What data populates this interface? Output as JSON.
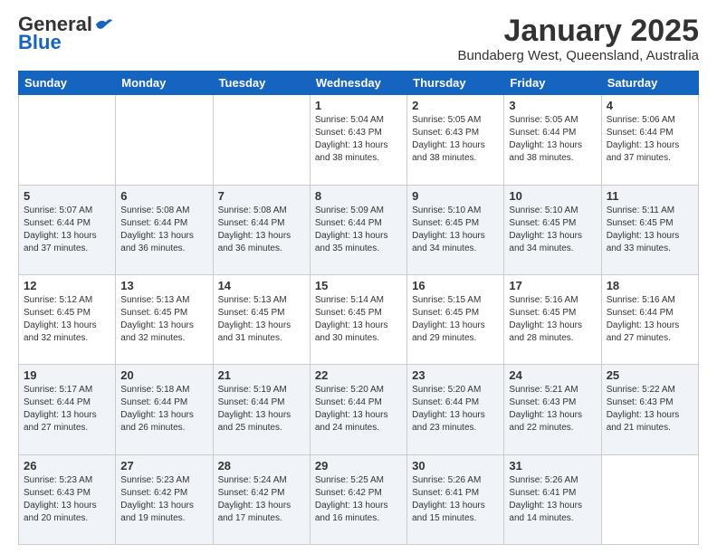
{
  "header": {
    "logo": {
      "general": "General",
      "blue": "Blue"
    },
    "title": "January 2025",
    "location": "Bundaberg West, Queensland, Australia"
  },
  "weekdays": [
    "Sunday",
    "Monday",
    "Tuesday",
    "Wednesday",
    "Thursday",
    "Friday",
    "Saturday"
  ],
  "weeks": [
    [
      {
        "day": "",
        "info": ""
      },
      {
        "day": "",
        "info": ""
      },
      {
        "day": "",
        "info": ""
      },
      {
        "day": "1",
        "info": "Sunrise: 5:04 AM\nSunset: 6:43 PM\nDaylight: 13 hours\nand 38 minutes."
      },
      {
        "day": "2",
        "info": "Sunrise: 5:05 AM\nSunset: 6:43 PM\nDaylight: 13 hours\nand 38 minutes."
      },
      {
        "day": "3",
        "info": "Sunrise: 5:05 AM\nSunset: 6:44 PM\nDaylight: 13 hours\nand 38 minutes."
      },
      {
        "day": "4",
        "info": "Sunrise: 5:06 AM\nSunset: 6:44 PM\nDaylight: 13 hours\nand 37 minutes."
      }
    ],
    [
      {
        "day": "5",
        "info": "Sunrise: 5:07 AM\nSunset: 6:44 PM\nDaylight: 13 hours\nand 37 minutes."
      },
      {
        "day": "6",
        "info": "Sunrise: 5:08 AM\nSunset: 6:44 PM\nDaylight: 13 hours\nand 36 minutes."
      },
      {
        "day": "7",
        "info": "Sunrise: 5:08 AM\nSunset: 6:44 PM\nDaylight: 13 hours\nand 36 minutes."
      },
      {
        "day": "8",
        "info": "Sunrise: 5:09 AM\nSunset: 6:44 PM\nDaylight: 13 hours\nand 35 minutes."
      },
      {
        "day": "9",
        "info": "Sunrise: 5:10 AM\nSunset: 6:45 PM\nDaylight: 13 hours\nand 34 minutes."
      },
      {
        "day": "10",
        "info": "Sunrise: 5:10 AM\nSunset: 6:45 PM\nDaylight: 13 hours\nand 34 minutes."
      },
      {
        "day": "11",
        "info": "Sunrise: 5:11 AM\nSunset: 6:45 PM\nDaylight: 13 hours\nand 33 minutes."
      }
    ],
    [
      {
        "day": "12",
        "info": "Sunrise: 5:12 AM\nSunset: 6:45 PM\nDaylight: 13 hours\nand 32 minutes."
      },
      {
        "day": "13",
        "info": "Sunrise: 5:13 AM\nSunset: 6:45 PM\nDaylight: 13 hours\nand 32 minutes."
      },
      {
        "day": "14",
        "info": "Sunrise: 5:13 AM\nSunset: 6:45 PM\nDaylight: 13 hours\nand 31 minutes."
      },
      {
        "day": "15",
        "info": "Sunrise: 5:14 AM\nSunset: 6:45 PM\nDaylight: 13 hours\nand 30 minutes."
      },
      {
        "day": "16",
        "info": "Sunrise: 5:15 AM\nSunset: 6:45 PM\nDaylight: 13 hours\nand 29 minutes."
      },
      {
        "day": "17",
        "info": "Sunrise: 5:16 AM\nSunset: 6:45 PM\nDaylight: 13 hours\nand 28 minutes."
      },
      {
        "day": "18",
        "info": "Sunrise: 5:16 AM\nSunset: 6:44 PM\nDaylight: 13 hours\nand 27 minutes."
      }
    ],
    [
      {
        "day": "19",
        "info": "Sunrise: 5:17 AM\nSunset: 6:44 PM\nDaylight: 13 hours\nand 27 minutes."
      },
      {
        "day": "20",
        "info": "Sunrise: 5:18 AM\nSunset: 6:44 PM\nDaylight: 13 hours\nand 26 minutes."
      },
      {
        "day": "21",
        "info": "Sunrise: 5:19 AM\nSunset: 6:44 PM\nDaylight: 13 hours\nand 25 minutes."
      },
      {
        "day": "22",
        "info": "Sunrise: 5:20 AM\nSunset: 6:44 PM\nDaylight: 13 hours\nand 24 minutes."
      },
      {
        "day": "23",
        "info": "Sunrise: 5:20 AM\nSunset: 6:44 PM\nDaylight: 13 hours\nand 23 minutes."
      },
      {
        "day": "24",
        "info": "Sunrise: 5:21 AM\nSunset: 6:43 PM\nDaylight: 13 hours\nand 22 minutes."
      },
      {
        "day": "25",
        "info": "Sunrise: 5:22 AM\nSunset: 6:43 PM\nDaylight: 13 hours\nand 21 minutes."
      }
    ],
    [
      {
        "day": "26",
        "info": "Sunrise: 5:23 AM\nSunset: 6:43 PM\nDaylight: 13 hours\nand 20 minutes."
      },
      {
        "day": "27",
        "info": "Sunrise: 5:23 AM\nSunset: 6:42 PM\nDaylight: 13 hours\nand 19 minutes."
      },
      {
        "day": "28",
        "info": "Sunrise: 5:24 AM\nSunset: 6:42 PM\nDaylight: 13 hours\nand 17 minutes."
      },
      {
        "day": "29",
        "info": "Sunrise: 5:25 AM\nSunset: 6:42 PM\nDaylight: 13 hours\nand 16 minutes."
      },
      {
        "day": "30",
        "info": "Sunrise: 5:26 AM\nSunset: 6:41 PM\nDaylight: 13 hours\nand 15 minutes."
      },
      {
        "day": "31",
        "info": "Sunrise: 5:26 AM\nSunset: 6:41 PM\nDaylight: 13 hours\nand 14 minutes."
      },
      {
        "day": "",
        "info": ""
      }
    ]
  ]
}
